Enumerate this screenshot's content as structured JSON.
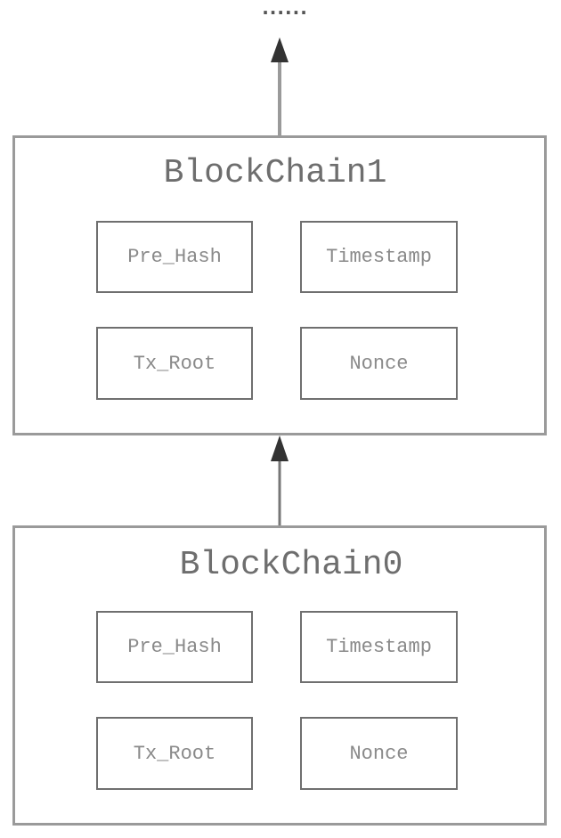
{
  "diagram": {
    "continuation": "······",
    "blocks": [
      {
        "title": "BlockChain1",
        "fields": [
          "Pre_Hash",
          "Timestamp",
          "Tx_Root",
          "Nonce"
        ]
      },
      {
        "title": "BlockChain0",
        "fields": [
          "Pre_Hash",
          "Timestamp",
          "Tx_Root",
          "Nonce"
        ]
      }
    ],
    "edges": [
      {
        "from": "BlockChain1",
        "to": "continuation"
      },
      {
        "from": "BlockChain0",
        "to": "BlockChain1"
      }
    ],
    "colors": {
      "outer_border": "#9a9a9a",
      "inner_border": "#6f6f6f",
      "arrow": "#333333",
      "text": "#7a7a7a"
    }
  }
}
